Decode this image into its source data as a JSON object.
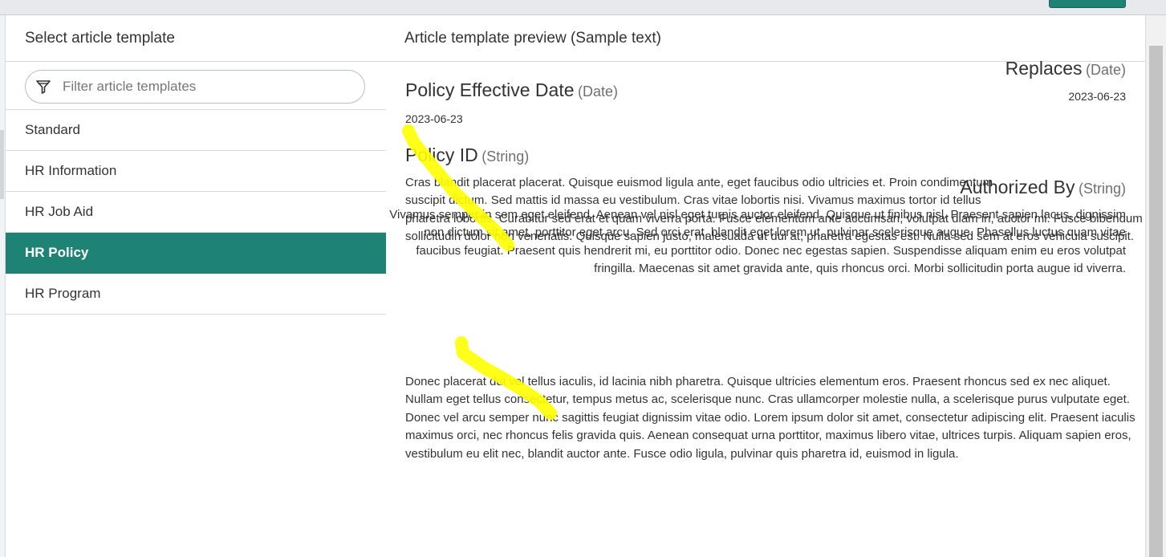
{
  "left_panel": {
    "title": "Select article template",
    "filter": {
      "placeholder": "Filter article templates",
      "value": ""
    },
    "templates": [
      {
        "label": "Standard"
      },
      {
        "label": "HR Information"
      },
      {
        "label": "HR Job Aid"
      },
      {
        "label": "HR Policy",
        "selected": true
      },
      {
        "label": "HR Program"
      }
    ]
  },
  "preview": {
    "title": "Article template preview (Sample text)",
    "fields": {
      "replaces": {
        "name": "Replaces",
        "type": "(Date)",
        "value": "2023-06-23"
      },
      "policy_effective_date": {
        "name": "Policy Effective Date",
        "type": "(Date)",
        "value": "2023-06-23"
      },
      "policy_id": {
        "name": "Policy ID",
        "type": "(String)"
      },
      "authorized_by": {
        "name": "Authorized By",
        "type": "(String)"
      }
    },
    "left_text_lines": [
      "Cras blandit placerat placerat. Quisque euismod ligula ante, eget faucibus odio ultricies et. Proin condimentum",
      "suscipit dictum. Sed mattis id massa eu vestibulum. Cras vitae lobortis nisi. Vivamus maximus tortor id tellus",
      "pharetra lobortis. Curabitur sed erat et quam viverra porta. Fusce elementum ante accumsan, volutpat diam in, auctor mi. Fusce bibendum",
      "sollicitudin dolor non venenatis. Quisque sapien justo, malesuada ut dui at, pharetra egestas est. Nulla sed sem at eros vehicula suscipit."
    ],
    "right_text_lines": [
      "Vivamus semper in sem eget eleifend. Aenean vel nisl eget turpis auctor eleifend. Quisque ut finibus nisl. Praesent sapien lacus, dignissim",
      "non dictum sit amet, porttitor eget arcu. Sed orci erat, blandit eget lorem ut, pulvinar scelerisque augue. Phasellus luctus quam vitae",
      "faucibus feugiat. Praesent quis hendrerit mi, eu porttitor odio. Donec nec egestas sapien. Suspendisse aliquam enim eu eros volutpat",
      "fringilla. Maecenas sit amet gravida ante, quis rhoncus orci. Morbi sollicitudin porta augue id viverra."
    ],
    "bottom_text_lines": [
      "Donec placerat dui vel tellus iaculis, id lacinia nibh pharetra. Quisque ultricies elementum eros. Praesent rhoncus sed ex nec aliquet.",
      "Nullam eget tellus consectetur, tempus metus ac, scelerisque nunc. Cras ullamcorper molestie nulla, a scelerisque purus vulputate eget.",
      "Donec vel arcu semper nunc sagittis feugiat dignissim vitae odio. Lorem ipsum dolor sit amet, consectetur adipiscing elit. Praesent iaculis",
      "maximus orci, nec rhoncus felis gravida quis. Aenean consequat urna porttitor, maximus libero vitae, ultrices turpis. Aliquam sapien eros,",
      "vestibulum eu elit nec, blandit auctor ante. Fusce odio ligula, pulvinar quis pharetra id, euismod in ligula."
    ]
  },
  "colors": {
    "accent": "#1e8374",
    "highlight": "#ffff00",
    "border": "#d6d9dd",
    "muted_text": "#707070"
  },
  "icons": {
    "filter": "funnel-icon"
  }
}
